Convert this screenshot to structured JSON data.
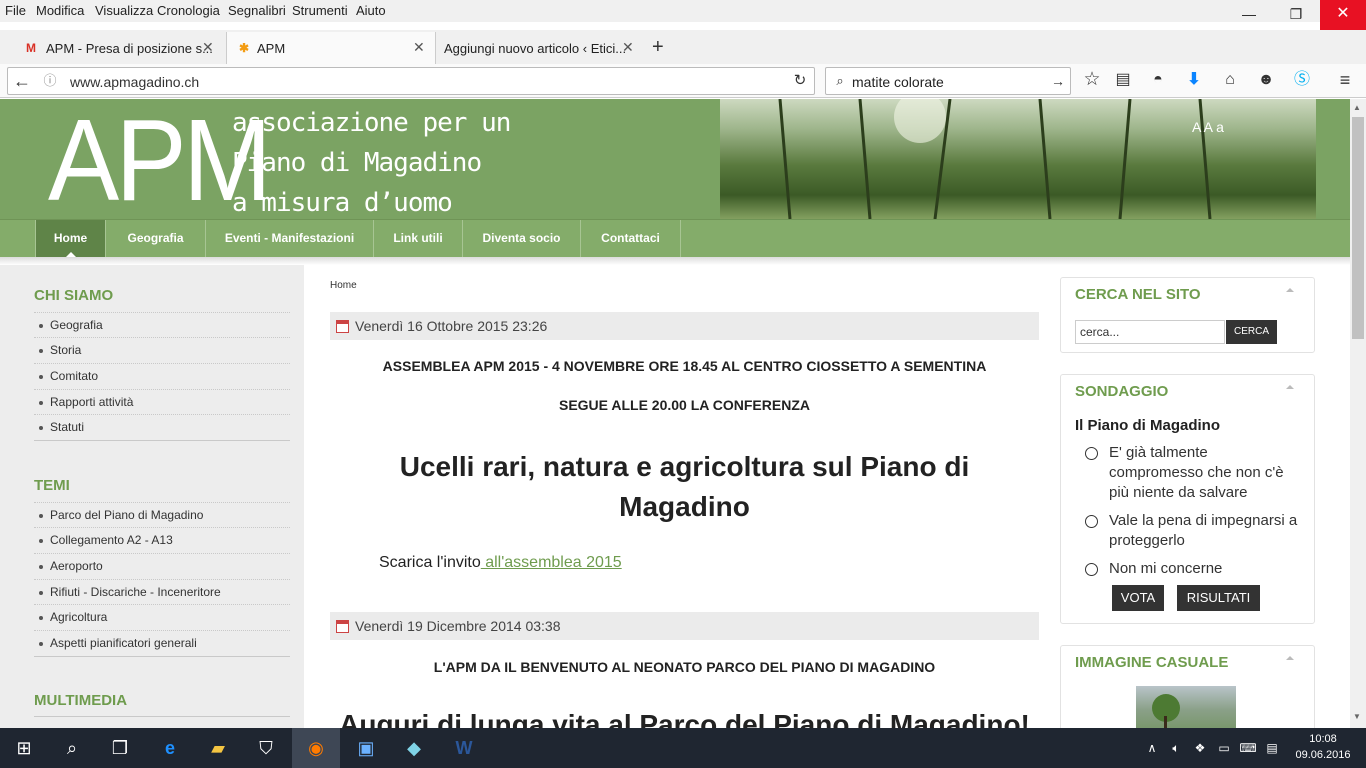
{
  "menubar": {
    "items": [
      "File",
      "Modifica",
      "Visualizza",
      "Cronologia",
      "Segnalibri",
      "Strumenti",
      "Aiuto"
    ]
  },
  "window": {
    "minimize": "—",
    "restore": "❐",
    "close": "✕"
  },
  "tabs": [
    {
      "title": "APM - Presa di posizione s...",
      "icon": "gmail-icon"
    },
    {
      "title": "APM",
      "icon": "joomla-icon"
    },
    {
      "title": "Aggiungi nuovo articolo ‹ Etici...",
      "icon": "none"
    }
  ],
  "navbar": {
    "url": "www.apmagadino.ch",
    "search_value": "matite colorate"
  },
  "site": {
    "logo": "APM",
    "tagline": [
      "associazione per un",
      "Piano di Magadino",
      "a misura d’uomo"
    ],
    "font_sizer": "A A a",
    "nav": [
      "Home",
      "Geografia",
      "Eventi - Manifestazioni",
      "Link utili",
      "Diventa socio",
      "Contattaci"
    ]
  },
  "sidebar": {
    "sections": [
      {
        "title": "CHI SIAMO",
        "items": [
          "Geografia",
          "Storia",
          "Comitato",
          "Rapporti attività",
          "Statuti"
        ]
      },
      {
        "title": "TEMI",
        "items": [
          "Parco del Piano di Magadino",
          "Collegamento A2 - A13",
          "Aeroporto",
          "Rifiuti - Discariche - Inceneritore",
          "Agricoltura",
          "Aspetti pianificatori generali"
        ]
      },
      {
        "title": "MULTIMEDIA",
        "items": []
      }
    ]
  },
  "content": {
    "breadcrumb": "Home",
    "articles": [
      {
        "date": "Venerdì 16 Ottobre 2015 23:26",
        "line1": "ASSEMBLEA APM 2015 - 4  NOVEMBRE ORE 18.45 AL CENTRO CIOSSETTO A SEMENTINA",
        "line2": "SEGUE ALLE 20.00  LA CONFERENZA",
        "heading": "Ucelli rari, natura e agricoltura sul Piano di Magadino",
        "body_text": "Scarica l'invito",
        "body_link": " all'assemblea 2015"
      },
      {
        "date": "Venerdì 19 Dicembre 2014 03:38",
        "line1": "L'APM DA IL BENVENUTO AL NEONATO PARCO DEL PIANO DI MAGADINO",
        "heading": "Auguri di lunga vita al Parco del Piano di Magadino!"
      }
    ]
  },
  "right": {
    "search": {
      "title": "CERCA NEL SITO",
      "placeholder": "cerca...",
      "button": "CERCA"
    },
    "poll": {
      "title": "SONDAGGIO",
      "question": "Il Piano di Magadino",
      "options": [
        "E' già talmente compromesso che non c'è più niente da salvare",
        "Vale la pena di impegnarsi a proteggerlo",
        "Non mi concerne"
      ],
      "vote": "VOTA",
      "results": "RISULTATI"
    },
    "random_image": {
      "title": "IMMAGINE CASUALE"
    }
  },
  "taskbar": {
    "time": "10:08",
    "date": "09.06.2016"
  }
}
